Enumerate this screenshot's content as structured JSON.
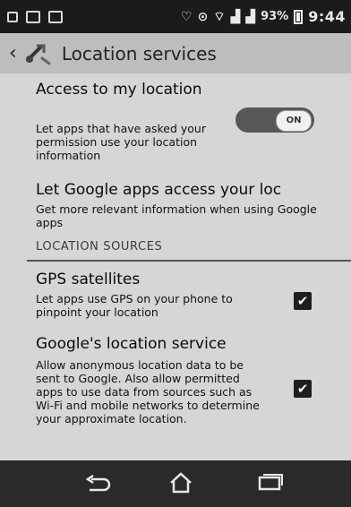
{
  "status_bar": {
    "battery_percent": "93%",
    "time": "9:44"
  },
  "action_bar": {
    "title": "Location services"
  },
  "settings": {
    "access": {
      "title": "Access to my location",
      "summary": "Let apps that have asked your permission use your location information",
      "toggle_label": "ON"
    },
    "google_apps": {
      "title": "Let Google apps access your loc",
      "summary": "Get more relevant information when using Google apps"
    },
    "section_header": "LOCATION SOURCES",
    "gps": {
      "title": "GPS satellites",
      "summary": "Let apps use GPS on your phone to pinpoint your location",
      "checked": true,
      "check_glyph": "✔"
    },
    "google_location": {
      "title": "Google's location service",
      "summary": "Allow anonymous location data to be sent to Google. Also allow permitted apps to use data from sources such as Wi-Fi and mobile networks to determine your approximate location.",
      "checked": true,
      "check_glyph": "✔"
    }
  },
  "icons": {
    "back": "back-chevron-icon",
    "app": "location-services-app-icon",
    "nav_back": "back-arrow-icon",
    "nav_home": "home-icon",
    "nav_recents": "recents-icon"
  }
}
